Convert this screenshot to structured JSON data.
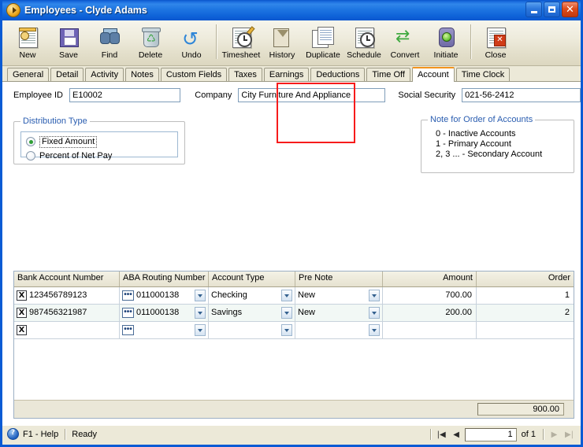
{
  "window": {
    "title": "Employees - Clyde Adams",
    "title_icon": "play-circle-icon",
    "controls": {
      "minimize": "minimize-icon",
      "maximize": "maximize-icon",
      "close": "close-icon"
    }
  },
  "toolbar": {
    "buttons": [
      {
        "label": "New",
        "icon": "new-record-icon"
      },
      {
        "label": "Save",
        "icon": "floppy-disk-icon"
      },
      {
        "label": "Find",
        "icon": "binoculars-icon"
      },
      {
        "label": "Delete",
        "icon": "recycle-bin-icon"
      },
      {
        "label": "Undo",
        "icon": "undo-arrow-icon"
      },
      {
        "label": "Timesheet",
        "icon": "timesheet-clock-icon"
      },
      {
        "label": "History",
        "icon": "hourglass-history-icon"
      },
      {
        "label": "Duplicate",
        "icon": "duplicate-pages-icon"
      },
      {
        "label": "Schedule",
        "icon": "schedule-calendar-icon"
      },
      {
        "label": "Convert",
        "icon": "convert-arrows-icon"
      },
      {
        "label": "Initiate",
        "icon": "traffic-light-icon"
      },
      {
        "label": "Close",
        "icon": "close-document-icon"
      }
    ]
  },
  "tabs": [
    {
      "label": "General",
      "active": false
    },
    {
      "label": "Detail",
      "active": false
    },
    {
      "label": "Activity",
      "active": false
    },
    {
      "label": "Notes",
      "active": false
    },
    {
      "label": "Custom Fields",
      "active": false
    },
    {
      "label": "Taxes",
      "active": false
    },
    {
      "label": "Earnings",
      "active": false
    },
    {
      "label": "Deductions",
      "active": false
    },
    {
      "label": "Time Off",
      "active": false
    },
    {
      "label": "Account",
      "active": true
    },
    {
      "label": "Time Clock",
      "active": false
    }
  ],
  "header_fields": {
    "employee_id_label": "Employee ID",
    "employee_id_value": "E10002",
    "company_label": "Company",
    "company_value": "City Furniture And Appliance",
    "social_security_label": "Social Security",
    "social_security_value": "021-56-2412"
  },
  "distribution_type": {
    "legend": "Distribution Type",
    "options": [
      {
        "label": "Fixed Amount",
        "selected": true,
        "focused": true
      },
      {
        "label": "Percent of Net Pay",
        "selected": false,
        "focused": false
      }
    ]
  },
  "note_box": {
    "legend": "Note for Order of Accounts",
    "lines": [
      "0 - Inactive Accounts",
      "1 - Primary Account",
      "2, 3 ... - Secondary Account"
    ]
  },
  "grid": {
    "columns": [
      "Bank Account Number",
      "ABA Routing Number",
      "Account Type",
      "Pre Note",
      "Amount",
      "Order"
    ],
    "rows": [
      {
        "delete_label": "X",
        "bank_account_number": "123456789123",
        "aba_routing_number": "011000138",
        "account_type": "Checking",
        "pre_note": "New",
        "amount": "700.00",
        "order": "1"
      },
      {
        "delete_label": "X",
        "bank_account_number": "987456321987",
        "aba_routing_number": "011000138",
        "account_type": "Savings",
        "pre_note": "New",
        "amount": "200.00",
        "order": "2"
      },
      {
        "delete_label": "X",
        "bank_account_number": "",
        "aba_routing_number": "",
        "account_type": "",
        "pre_note": "",
        "amount": "",
        "order": ""
      }
    ],
    "total": "900.00"
  },
  "annotation": {
    "color": "#F71B1B",
    "target_column": "Pre Note"
  },
  "statusbar": {
    "help_label": "F1 - Help",
    "status_text": "Ready",
    "nav": {
      "first": "first-record-icon",
      "previous": "previous-record-icon",
      "current": "1",
      "of_label": "of  1",
      "next": "next-record-icon",
      "last": "last-record-icon"
    }
  }
}
